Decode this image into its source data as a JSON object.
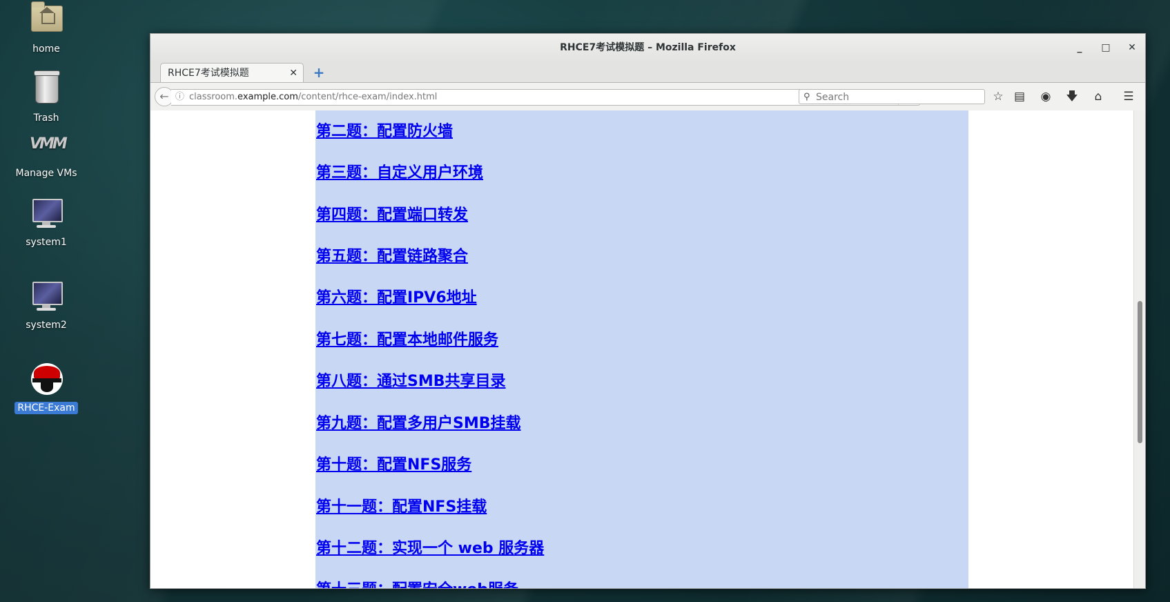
{
  "desktop": {
    "icons": [
      {
        "label": "home"
      },
      {
        "label": "Trash"
      },
      {
        "label": "Manage VMs"
      },
      {
        "label": "system1"
      },
      {
        "label": "system2"
      },
      {
        "label": "RHCE-Exam"
      }
    ]
  },
  "window": {
    "title": "RHCE7考试模拟题 – Mozilla Firefox",
    "minimize": "_",
    "maximize": "□",
    "close": "✕"
  },
  "tab": {
    "label": "RHCE7考试模拟题",
    "close": "✕",
    "new_tab": "+"
  },
  "navbar": {
    "url_prefix": "classroom.",
    "url_host": "example.com",
    "url_path": "/content/rhce-exam/index.html",
    "search_placeholder": "Search"
  },
  "page": {
    "links": [
      "第二题：配置防火墙",
      "第三题：自定义用户环境",
      "第四题：配置端口转发",
      "第五题：配置链路聚合",
      "第六题：配置IPV6地址",
      "第七题：配置本地邮件服务",
      "第八题：通过SMB共享目录",
      "第九题：配置多用户SMB挂载",
      "第十题：配置NFS服务",
      "第十一题：配置NFS挂载",
      "第十二题：实现一个 web 服务器",
      "第十三题：配置安全web服务"
    ]
  }
}
